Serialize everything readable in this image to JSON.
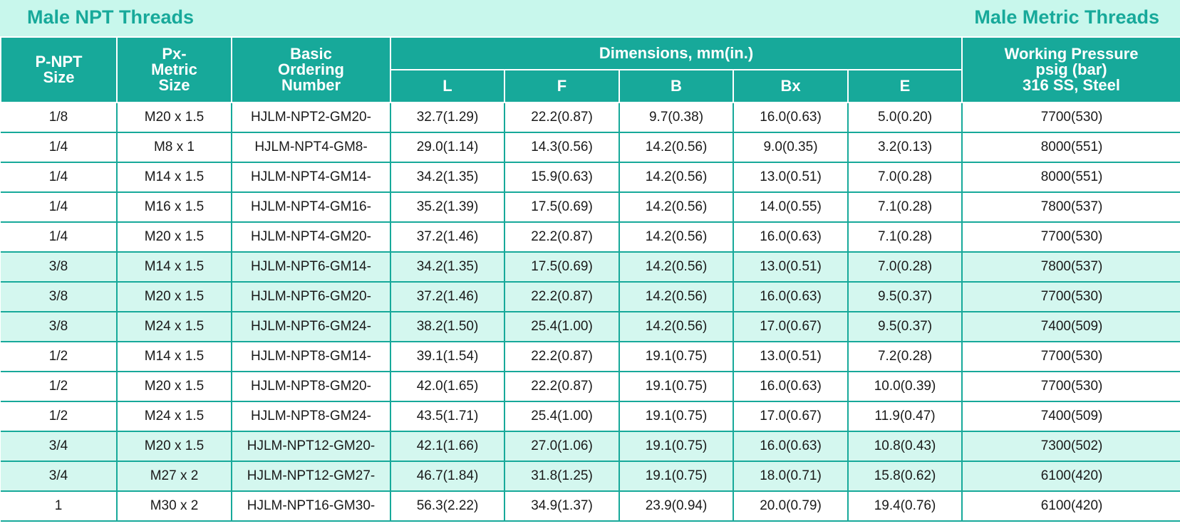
{
  "titles": {
    "left": "Male NPT Threads",
    "right": "Male Metric Threads"
  },
  "header": {
    "pnpt_line1": "P-NPT",
    "pnpt_line2": "Size",
    "px_line1": "Px-",
    "px_line2": "Metric",
    "px_line3": "Size",
    "basic_line1": "Basic",
    "basic_line2": "Ordering",
    "basic_line3": "Number",
    "dimensions": "Dimensions, mm(in.)",
    "pressure_line1": "Working Pressure",
    "pressure_line2": "psig (bar)",
    "pressure_line3": "316 SS, Steel",
    "L": "L",
    "F": "F",
    "B": "B",
    "Bx": "Bx",
    "E": "E"
  },
  "colors": {
    "accent": "#17a99a",
    "title_band": "#c8f7ec",
    "row_band": "#d4f7ef"
  },
  "rows": [
    {
      "pnpt": "1/8",
      "px": "M20 x 1.5",
      "order": "HJLM-NPT2-GM20-",
      "L": "32.7(1.29)",
      "F": "22.2(0.87)",
      "B": "9.7(0.38)",
      "Bx": "16.0(0.63)",
      "E": "5.0(0.20)",
      "pressure": "7700(530)"
    },
    {
      "pnpt": "1/4",
      "px": "M8 x 1",
      "order": "HJLM-NPT4-GM8-",
      "L": "29.0(1.14)",
      "F": "14.3(0.56)",
      "B": "14.2(0.56)",
      "Bx": "9.0(0.35)",
      "E": "3.2(0.13)",
      "pressure": "8000(551)"
    },
    {
      "pnpt": "1/4",
      "px": "M14 x 1.5",
      "order": "HJLM-NPT4-GM14-",
      "L": "34.2(1.35)",
      "F": "15.9(0.63)",
      "B": "14.2(0.56)",
      "Bx": "13.0(0.51)",
      "E": "7.0(0.28)",
      "pressure": "8000(551)"
    },
    {
      "pnpt": "1/4",
      "px": "M16 x 1.5",
      "order": "HJLM-NPT4-GM16-",
      "L": "35.2(1.39)",
      "F": "17.5(0.69)",
      "B": "14.2(0.56)",
      "Bx": "14.0(0.55)",
      "E": "7.1(0.28)",
      "pressure": "7800(537)"
    },
    {
      "pnpt": "1/4",
      "px": "M20 x 1.5",
      "order": "HJLM-NPT4-GM20-",
      "L": "37.2(1.46)",
      "F": "22.2(0.87)",
      "B": "14.2(0.56)",
      "Bx": "16.0(0.63)",
      "E": "7.1(0.28)",
      "pressure": "7700(530)"
    },
    {
      "pnpt": "3/8",
      "px": "M14 x 1.5",
      "order": "HJLM-NPT6-GM14-",
      "L": "34.2(1.35)",
      "F": "17.5(0.69)",
      "B": "14.2(0.56)",
      "Bx": "13.0(0.51)",
      "E": "7.0(0.28)",
      "pressure": "7800(537)"
    },
    {
      "pnpt": "3/8",
      "px": "M20 x 1.5",
      "order": "HJLM-NPT6-GM20-",
      "L": "37.2(1.46)",
      "F": "22.2(0.87)",
      "B": "14.2(0.56)",
      "Bx": "16.0(0.63)",
      "E": "9.5(0.37)",
      "pressure": "7700(530)"
    },
    {
      "pnpt": "3/8",
      "px": "M24 x 1.5",
      "order": "HJLM-NPT6-GM24-",
      "L": "38.2(1.50)",
      "F": "25.4(1.00)",
      "B": "14.2(0.56)",
      "Bx": "17.0(0.67)",
      "E": "9.5(0.37)",
      "pressure": "7400(509)"
    },
    {
      "pnpt": "1/2",
      "px": "M14 x 1.5",
      "order": "HJLM-NPT8-GM14-",
      "L": "39.1(1.54)",
      "F": "22.2(0.87)",
      "B": "19.1(0.75)",
      "Bx": "13.0(0.51)",
      "E": "7.2(0.28)",
      "pressure": "7700(530)"
    },
    {
      "pnpt": "1/2",
      "px": "M20 x 1.5",
      "order": "HJLM-NPT8-GM20-",
      "L": "42.0(1.65)",
      "F": "22.2(0.87)",
      "B": "19.1(0.75)",
      "Bx": "16.0(0.63)",
      "E": "10.0(0.39)",
      "pressure": "7700(530)"
    },
    {
      "pnpt": "1/2",
      "px": "M24 x 1.5",
      "order": "HJLM-NPT8-GM24-",
      "L": "43.5(1.71)",
      "F": "25.4(1.00)",
      "B": "19.1(0.75)",
      "Bx": "17.0(0.67)",
      "E": "11.9(0.47)",
      "pressure": "7400(509)"
    },
    {
      "pnpt": "3/4",
      "px": "M20 x 1.5",
      "order": "HJLM-NPT12-GM20-",
      "L": "42.1(1.66)",
      "F": "27.0(1.06)",
      "B": "19.1(0.75)",
      "Bx": "16.0(0.63)",
      "E": "10.8(0.43)",
      "pressure": "7300(502)"
    },
    {
      "pnpt": "3/4",
      "px": "M27 x 2",
      "order": "HJLM-NPT12-GM27-",
      "L": "46.7(1.84)",
      "F": "31.8(1.25)",
      "B": "19.1(0.75)",
      "Bx": "18.0(0.71)",
      "E": "15.8(0.62)",
      "pressure": "6100(420)"
    },
    {
      "pnpt": "1",
      "px": "M30 x 2",
      "order": "HJLM-NPT16-GM30-",
      "L": "56.3(2.22)",
      "F": "34.9(1.37)",
      "B": "23.9(0.94)",
      "Bx": "20.0(0.79)",
      "E": "19.4(0.76)",
      "pressure": "6100(420)"
    }
  ]
}
